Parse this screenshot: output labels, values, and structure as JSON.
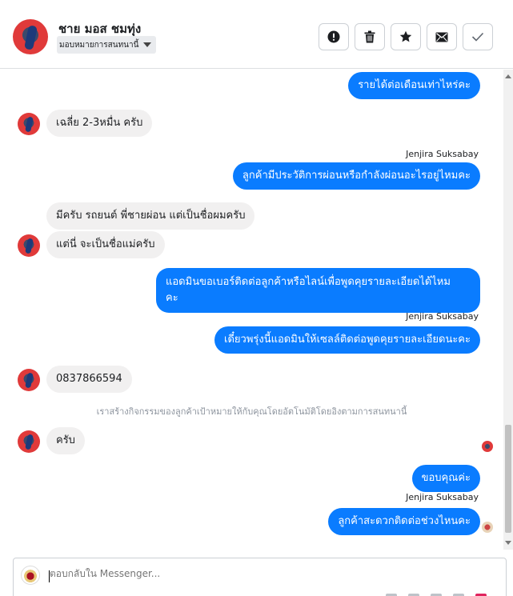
{
  "header": {
    "contact_name": "ชาย มอส ชมทุ่ง",
    "assign_label": "มอบหมายการสนทนานี้",
    "buttons": [
      {
        "icon": "alert-icon",
        "name": "mark-spam-button"
      },
      {
        "icon": "trash-icon",
        "name": "delete-button"
      },
      {
        "icon": "star-icon",
        "name": "star-button"
      },
      {
        "icon": "envelope-icon",
        "name": "mark-unread-button"
      },
      {
        "icon": "check-icon",
        "name": "mark-done-button"
      }
    ]
  },
  "messages": {
    "m1": "รายได้ต่อเดือนเท่าไหร่คะ",
    "m2": "เฉลี่ย 2-3หมื่น ครับ",
    "sender1": "Jenjira Suksabay",
    "m3": "ลูกค้ามีประวัติการผ่อนหรือกำลังผ่อนอะไรอยู่ไหมคะ",
    "m4": "มีครับ รถยนต์ พี่ชายผ่อน แต่เป็นชื่อผมครับ",
    "m5": "แต่นี่ จะเป็นชื่อแม่ครับ",
    "m6_line1": "แอดมินขอเบอร์ติดต่อลูกค้าหรือไลน์เพื่อพูดคุยรายละเอียดได้ไหม",
    "m6_line2": "คะ",
    "sender2": "Jenjira Suksabay",
    "m7": "เดี๋ยวพรุ่งนี้แอดมินให้เซลล์ติดต่อพูดคุยรายละเอียดนะคะ",
    "m8": "0837866594",
    "system_note": "เราสร้างกิจกรรมของลูกค้าเป้าหมายให้กับคุณโดยอัตโนมัติโดยอิงตามการสนทนานี้",
    "m9": "ครับ",
    "m10": "ขอบคุณค่ะ",
    "sender3": "Jenjira Suksabay",
    "m11": "ลูกค้าสะดวกติดต่อช่วงไหนคะ"
  },
  "composer": {
    "placeholder": "ตอบกลับใน Messenger..."
  },
  "colors": {
    "outgoing_bubble": "#0a7cff",
    "incoming_bubble": "#f1f0f0"
  }
}
